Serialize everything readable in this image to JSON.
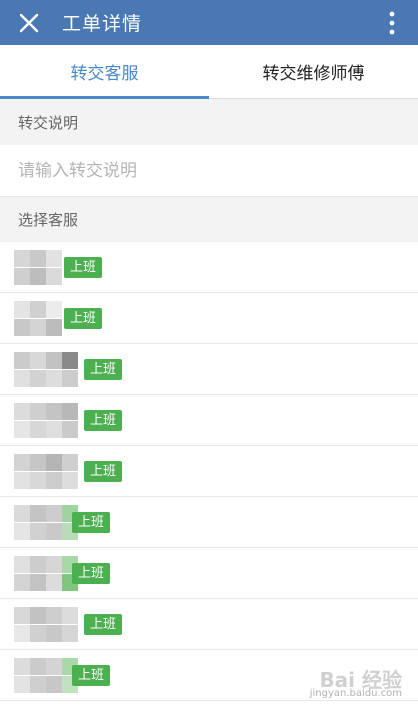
{
  "header": {
    "title": "工单详情",
    "close_icon": "close-icon",
    "more_icon": "more-vertical-icon",
    "background": "#4a78b2"
  },
  "tabs": [
    {
      "label": "转交客服",
      "active": true
    },
    {
      "label": "转交维修师傅",
      "active": false
    }
  ],
  "transfer_note": {
    "section_label": "转交说明",
    "placeholder": "请输入转交说明",
    "value": ""
  },
  "service_section": {
    "section_label": "选择客服"
  },
  "staff": [
    {
      "status": "上班"
    },
    {
      "status": "上班"
    },
    {
      "status": "上班"
    },
    {
      "status": "上班"
    },
    {
      "status": "上班"
    },
    {
      "status": "上班"
    },
    {
      "status": "上班"
    },
    {
      "status": "上班"
    },
    {
      "status": "上班"
    }
  ],
  "status_color": "#4caf50",
  "accent_color": "#4a88cc"
}
